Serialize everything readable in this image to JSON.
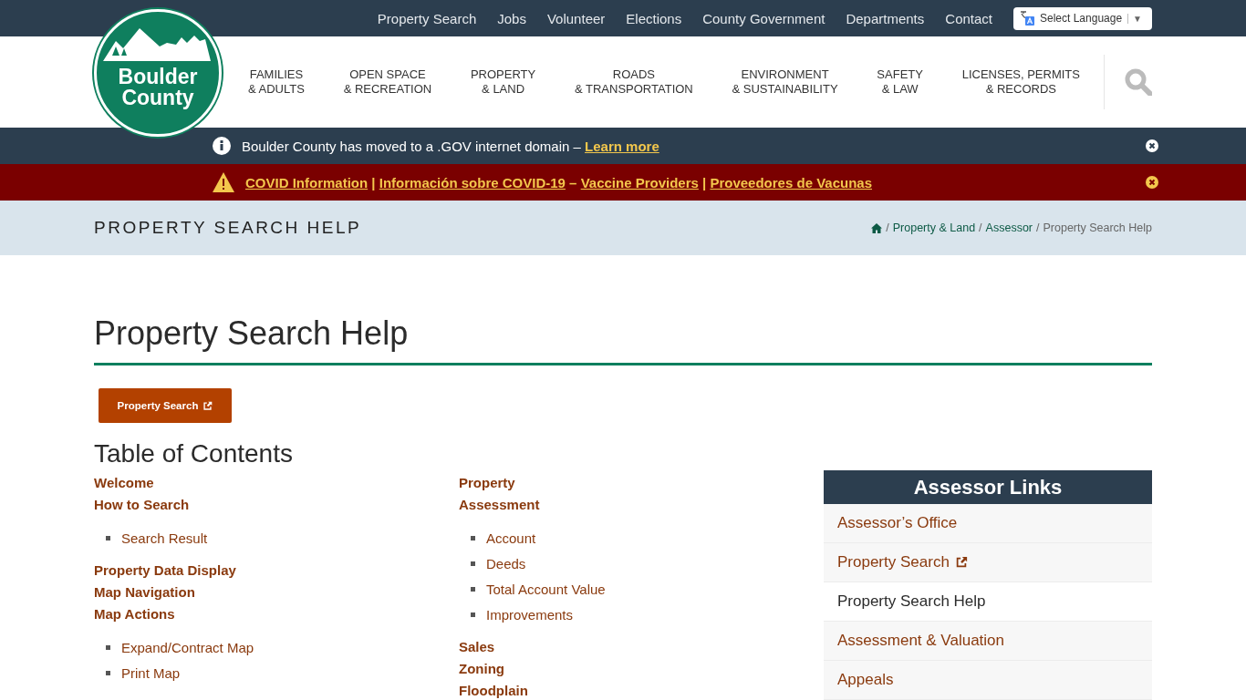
{
  "top_nav": {
    "links": [
      "Property Search",
      "Jobs",
      "Volunteer",
      "Elections",
      "County Government",
      "Departments",
      "Contact"
    ],
    "language_select": {
      "label": "Select Language",
      "caret": "▼"
    }
  },
  "logo": {
    "lines": [
      "Boulder",
      "County"
    ]
  },
  "main_nav": [
    {
      "lines": [
        "FAMILIES",
        "& ADULTS"
      ]
    },
    {
      "lines": [
        "OPEN SPACE",
        "& RECREATION"
      ]
    },
    {
      "lines": [
        "PROPERTY",
        "& LAND"
      ]
    },
    {
      "lines": [
        "ROADS",
        "& TRANSPORTATION"
      ]
    },
    {
      "lines": [
        "ENVIRONMENT",
        "& SUSTAINABILITY"
      ]
    },
    {
      "lines": [
        "SAFETY",
        "& LAW"
      ]
    },
    {
      "lines": [
        "LICENSES, PERMITS",
        "& RECORDS"
      ]
    }
  ],
  "notices": [
    {
      "kind": "info",
      "parts": [
        {
          "kind": "text",
          "text": "Boulder County has moved to a .GOV internet domain – "
        },
        {
          "kind": "link",
          "text": "Learn more"
        }
      ]
    },
    {
      "kind": "alert",
      "parts": [
        {
          "kind": "link",
          "text": "COVID Information"
        },
        {
          "kind": "text",
          "text": " | "
        },
        {
          "kind": "link",
          "text": "Información sobre COVID-19"
        },
        {
          "kind": "text",
          "text": " – "
        },
        {
          "kind": "link",
          "text": "Vaccine Providers"
        },
        {
          "kind": "text",
          "text": " | "
        },
        {
          "kind": "link",
          "text": "Proveedores de Vacunas"
        }
      ]
    }
  ],
  "page_band": {
    "title": "PROPERTY SEARCH HELP",
    "breadcrumb": {
      "links": [
        "Property & Land",
        "Assessor"
      ],
      "separator": "/",
      "current": "Property Search Help"
    }
  },
  "heading": "Property Search Help",
  "search_button": {
    "label": "Property Search"
  },
  "toc": {
    "title": "Table of Contents",
    "columns": [
      [
        {
          "kind": "links",
          "items": [
            "Welcome",
            "How to Search"
          ]
        },
        {
          "kind": "bullets",
          "items": [
            "Search Result"
          ]
        },
        {
          "kind": "links",
          "items": [
            "Property Data Display",
            "Map Navigation",
            "Map Actions"
          ]
        },
        {
          "kind": "bullets",
          "items": [
            "Expand/Contract Map",
            "Print Map"
          ]
        }
      ],
      [
        {
          "kind": "links",
          "items": [
            "Property",
            "Assessment"
          ]
        },
        {
          "kind": "bullets",
          "items": [
            "Account",
            "Deeds",
            "Total Account Value",
            "Improvements"
          ]
        },
        {
          "kind": "links",
          "items": [
            "Sales",
            "Zoning",
            "Floodplain"
          ]
        }
      ]
    ]
  },
  "sidebar": {
    "title": "Assessor Links",
    "items": [
      {
        "text": "Assessor’s Office",
        "external": false,
        "selected": false
      },
      {
        "text": "Property Search",
        "external": true,
        "selected": false
      },
      {
        "text": "Property Search Help",
        "external": false,
        "selected": true
      },
      {
        "text": "Assessment & Valuation",
        "external": false,
        "selected": false
      },
      {
        "text": "Appeals",
        "external": false,
        "selected": false
      }
    ]
  }
}
